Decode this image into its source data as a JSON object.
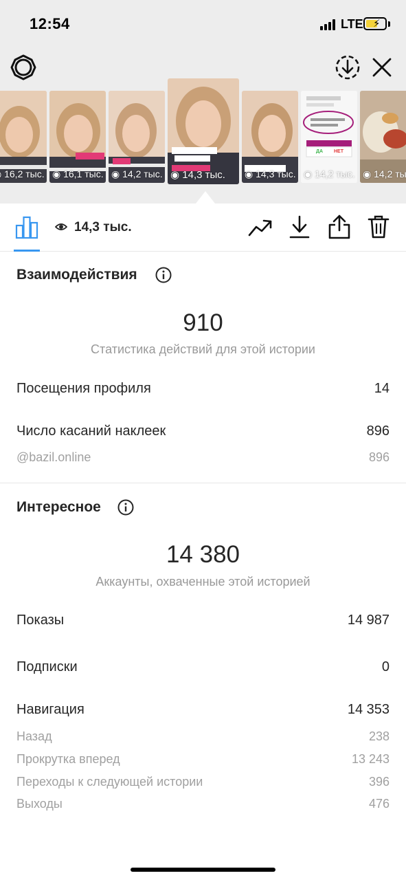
{
  "status_bar": {
    "time": "12:54",
    "network": "LTE"
  },
  "header": {
    "settings_icon": "gear-icon",
    "download_icon": "circle-download-icon",
    "close_icon": "close-icon"
  },
  "stories": [
    {
      "views": "16,2 тыс.",
      "caption": ""
    },
    {
      "views": "16,1 тыс.",
      "caption": "@bazil.online"
    },
    {
      "views": "14,2 тыс.",
      "caption": "А ещё!"
    },
    {
      "views": "14,3 тыс.",
      "caption": "Очень полезный блог",
      "caption2": "ПОДПИШИТЕСЬ",
      "handle": "@bazil.online",
      "selected": true
    },
    {
      "views": "14,3 тыс.",
      "caption": "В планах пригласить"
    },
    {
      "views": "14,2 тыс.",
      "caption": "",
      "poll_yes": "ДА",
      "poll_no": "НЕТ"
    },
    {
      "views": "14,2 тыс.",
      "caption": ""
    }
  ],
  "toolbar": {
    "reach": "14,3 тыс.",
    "stats_icon": "bar-chart-icon",
    "eye_icon": "eye-icon",
    "promote_icon": "trend-up-icon",
    "save_icon": "download-icon",
    "share_icon": "share-icon",
    "delete_icon": "trash-icon"
  },
  "interactions": {
    "title": "Взаимодействия",
    "total": "910",
    "subtitle": "Статистика действий для этой истории",
    "rows": [
      {
        "label": "Посещения профиля",
        "value": "14"
      },
      {
        "label": "Число касаний наклеек",
        "value": "896"
      }
    ],
    "sub_rows": [
      {
        "label": "@bazil.online",
        "value": "896"
      }
    ]
  },
  "discovery": {
    "title": "Интересное",
    "total": "14 380",
    "subtitle": "Аккаунты, охваченные этой историей",
    "rows": [
      {
        "label": "Показы",
        "value": "14 987"
      },
      {
        "label": "Подписки",
        "value": "0"
      },
      {
        "label": "Навигация",
        "value": "14 353"
      }
    ],
    "navigation": [
      {
        "label": "Назад",
        "value": "238"
      },
      {
        "label": "Прокрутка вперед",
        "value": "13 243"
      },
      {
        "label": "Переходы к следующей истории",
        "value": "396"
      },
      {
        "label": "Выходы",
        "value": "476"
      }
    ]
  },
  "colors": {
    "accent": "#3897f0",
    "muted": "#999999",
    "text": "#262626",
    "battery": "#f5d33a"
  }
}
